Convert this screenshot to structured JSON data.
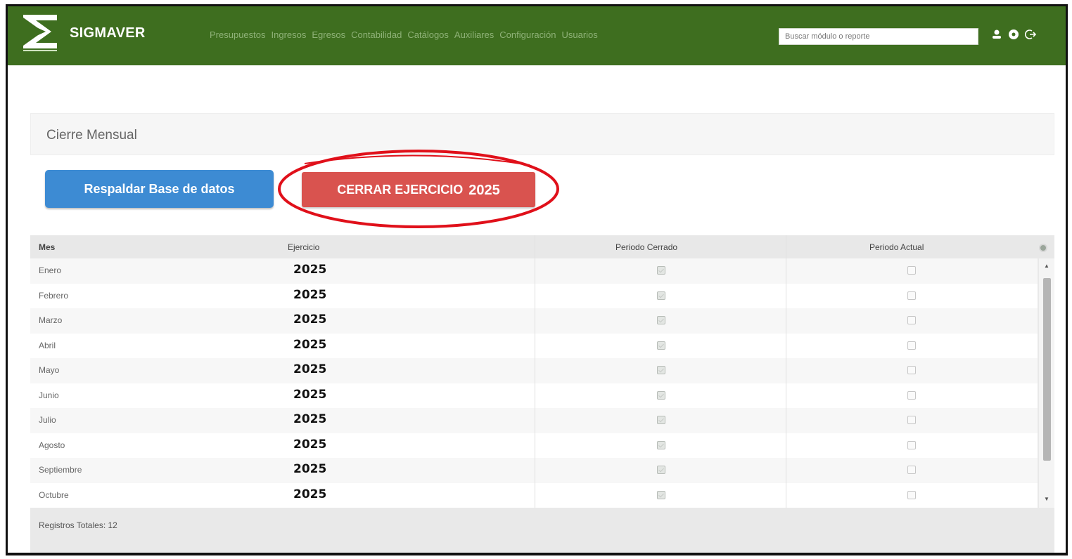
{
  "brand": {
    "name": "SIGMAVER"
  },
  "nav": {
    "items": [
      "Presupuestos",
      "Ingresos",
      "Egresos",
      "Contabilidad",
      "Catálogos",
      "Auxiliares",
      "Configuración",
      "Usuarios"
    ],
    "search_placeholder": "Buscar módulo o reporte",
    "icons": [
      "user-icon",
      "help-icon",
      "logout-icon"
    ]
  },
  "page": {
    "title": "Cierre Mensual"
  },
  "buttons": {
    "backup_label": "Respaldar Base de datos",
    "close_year_label": "CERRAR EJERCICIO",
    "close_year_value": "2025"
  },
  "grid": {
    "columns": [
      "Mes",
      "Ejercicio",
      "Periodo Cerrado",
      "Periodo Actual"
    ],
    "rows": [
      {
        "mes": "Enero",
        "ejercicio": "2025",
        "cerrado": true,
        "actual": false
      },
      {
        "mes": "Febrero",
        "ejercicio": "2025",
        "cerrado": true,
        "actual": false
      },
      {
        "mes": "Marzo",
        "ejercicio": "2025",
        "cerrado": true,
        "actual": false
      },
      {
        "mes": "Abril",
        "ejercicio": "2025",
        "cerrado": true,
        "actual": false
      },
      {
        "mes": "Mayo",
        "ejercicio": "2025",
        "cerrado": true,
        "actual": false
      },
      {
        "mes": "Junio",
        "ejercicio": "2025",
        "cerrado": true,
        "actual": false
      },
      {
        "mes": "Julio",
        "ejercicio": "2025",
        "cerrado": true,
        "actual": false
      },
      {
        "mes": "Agosto",
        "ejercicio": "2025",
        "cerrado": true,
        "actual": false
      },
      {
        "mes": "Septiembre",
        "ejercicio": "2025",
        "cerrado": true,
        "actual": false
      },
      {
        "mes": "Octubre",
        "ejercicio": "2025",
        "cerrado": true,
        "actual": false
      }
    ],
    "footer": "Registros Totales: 12"
  },
  "colors": {
    "navbar": "#3e6e1f",
    "backup_button": "#3d8bd3",
    "close_button": "#d9534f",
    "annotation": "#e0101a"
  }
}
